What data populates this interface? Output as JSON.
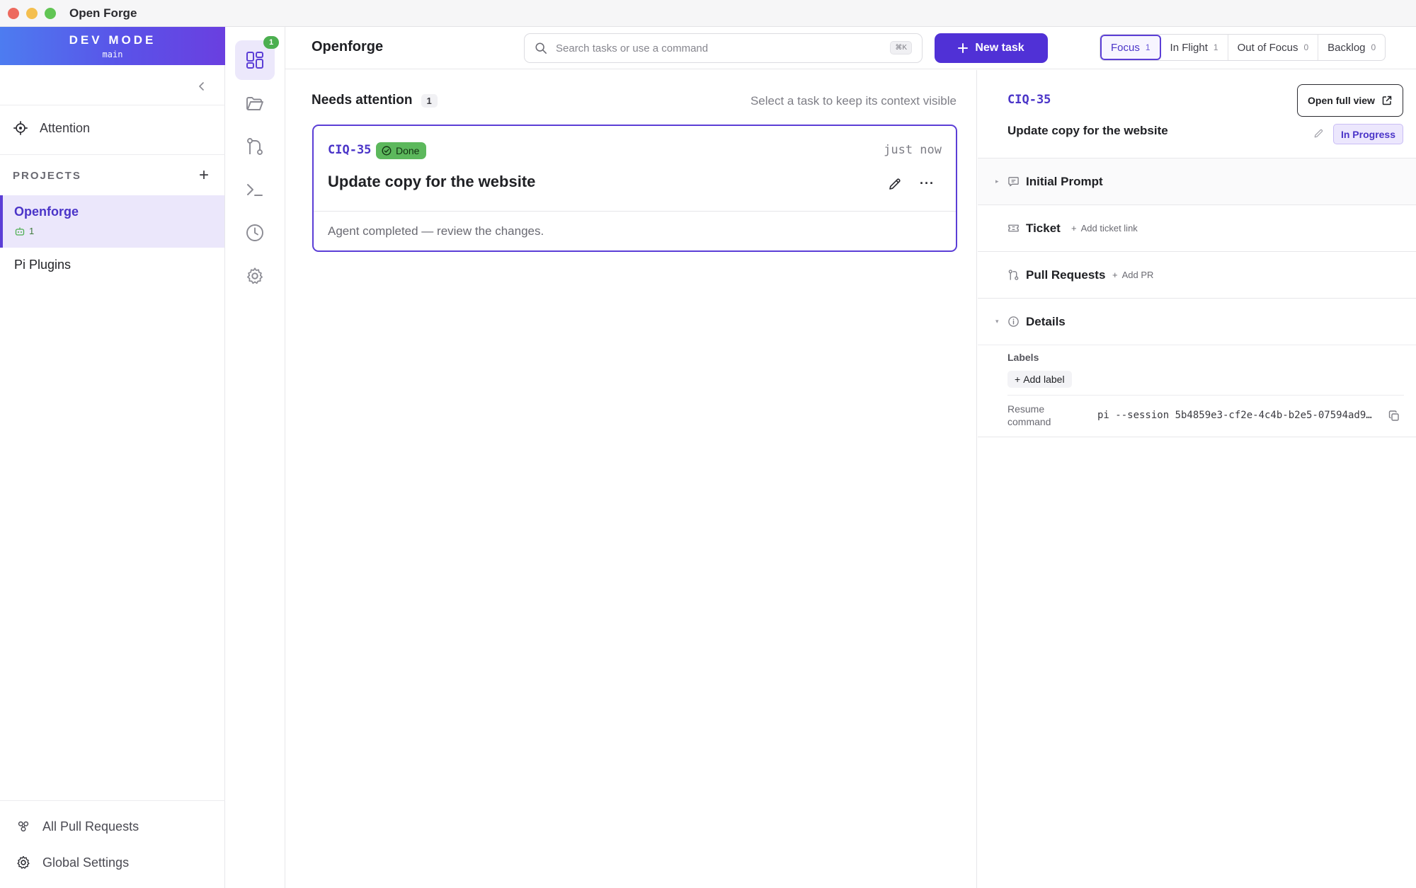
{
  "window": {
    "title": "Open Forge"
  },
  "sidebar": {
    "dev_mode": {
      "title": "DEV MODE",
      "branch": "main"
    },
    "attention_label": "Attention",
    "projects_label": "PROJECTS",
    "projects": [
      {
        "name": "Openforge",
        "count": "1",
        "active": true
      },
      {
        "name": "Pi Plugins",
        "active": false
      }
    ],
    "bottom": {
      "all_prs": "All Pull Requests",
      "global_settings": "Global Settings"
    }
  },
  "rail": {
    "items": [
      "dashboard-icon",
      "folder-icon",
      "git-branch-icon",
      "terminal-icon",
      "clock-icon",
      "gear-icon"
    ],
    "badge": "1"
  },
  "header": {
    "project_title": "Openforge",
    "search_placeholder": "Search tasks or use a command",
    "search_shortcut": "⌘K",
    "new_task_label": "New task",
    "tabs": [
      {
        "label": "Focus",
        "count": "1",
        "active": true
      },
      {
        "label": "In Flight",
        "count": "1",
        "active": false
      },
      {
        "label": "Out of Focus",
        "count": "0",
        "active": false
      },
      {
        "label": "Backlog",
        "count": "0",
        "active": false
      }
    ]
  },
  "main": {
    "section_title": "Needs attention",
    "section_count": "1",
    "hint": "Select a task to keep its context visible",
    "card": {
      "id": "CIQ-35",
      "status": "Done",
      "time": "just now",
      "title": "Update copy for the website",
      "message": "Agent completed — review the changes."
    }
  },
  "detail": {
    "id": "CIQ-35",
    "open_full_label": "Open full view",
    "title": "Update copy for the website",
    "status": "In Progress",
    "sections": {
      "initial_prompt": "Initial Prompt",
      "ticket": "Ticket",
      "ticket_add": "Add ticket link",
      "pull_requests": "Pull Requests",
      "pr_add": "Add PR",
      "details": "Details"
    },
    "labels_title": "Labels",
    "add_label": "Add label",
    "resume_label": "Resume command",
    "resume_command": "pi --session 5b4859e3-cf2e-4c4b-b2e5-07594ad9…"
  },
  "colors": {
    "accent": "#5031d6",
    "accent_text": "#4a34c8",
    "done_green": "#5cb85c",
    "dev_mode_gradient_start": "#4d7cf0",
    "dev_mode_gradient_end": "#6a3fe0"
  }
}
